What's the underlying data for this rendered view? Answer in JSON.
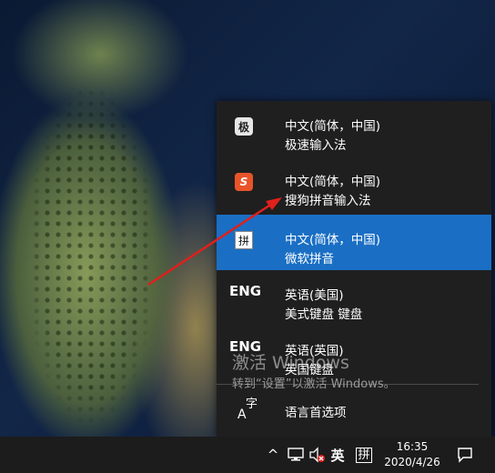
{
  "watermark": {
    "title": "激活 Windows",
    "subtitle": "转到“设置”以激活 Windows。"
  },
  "ime_menu": {
    "items": [
      {
        "line1": "中文(简体，中国)",
        "line2": "极速输入法",
        "icon": "ji-ime-icon",
        "icon_text": "极"
      },
      {
        "line1": "中文(简体，中国)",
        "line2": "搜狗拼音输入法",
        "icon": "sogou-icon",
        "icon_text": "S"
      },
      {
        "line1": "中文(简体，中国)",
        "line2": "微软拼音",
        "icon": "pinyin-icon",
        "icon_text": "拼",
        "selected": true
      },
      {
        "line1": "英语(美国)",
        "line2": "美式键盘 键盘",
        "icon": "eng-icon",
        "icon_text": "ENG"
      },
      {
        "line1": "英语(英国)",
        "line2": "英国键盘",
        "icon": "eng-icon",
        "icon_text": "ENG"
      }
    ],
    "language_preferences": {
      "label": "语言首选项",
      "icon_text": "字"
    },
    "selected_color": "#1a6fc4"
  },
  "taskbar": {
    "tray": {
      "chevron": "^",
      "input_mode": "英",
      "ime_indicator": "拼"
    },
    "clock": {
      "time": "16:35",
      "date": "2020/4/26"
    }
  },
  "annotation": {
    "color": "#e0201c"
  }
}
